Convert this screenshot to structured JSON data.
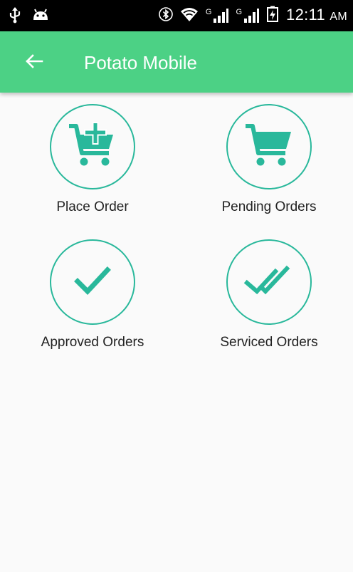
{
  "status_bar": {
    "time": "12:11",
    "ampm": "AM",
    "net_label_1": "G",
    "net_label_2": "G"
  },
  "appbar": {
    "title": "Potato Mobile",
    "back_icon": "arrow-back-icon",
    "color": "#4cd185"
  },
  "accent_color": "#29b89b",
  "tiles": [
    {
      "label": "Place Order",
      "icon": "cart-add-icon"
    },
    {
      "label": "Pending Orders",
      "icon": "cart-icon"
    },
    {
      "label": "Approved Orders",
      "icon": "check-icon"
    },
    {
      "label": "Serviced Orders",
      "icon": "double-check-icon"
    }
  ]
}
